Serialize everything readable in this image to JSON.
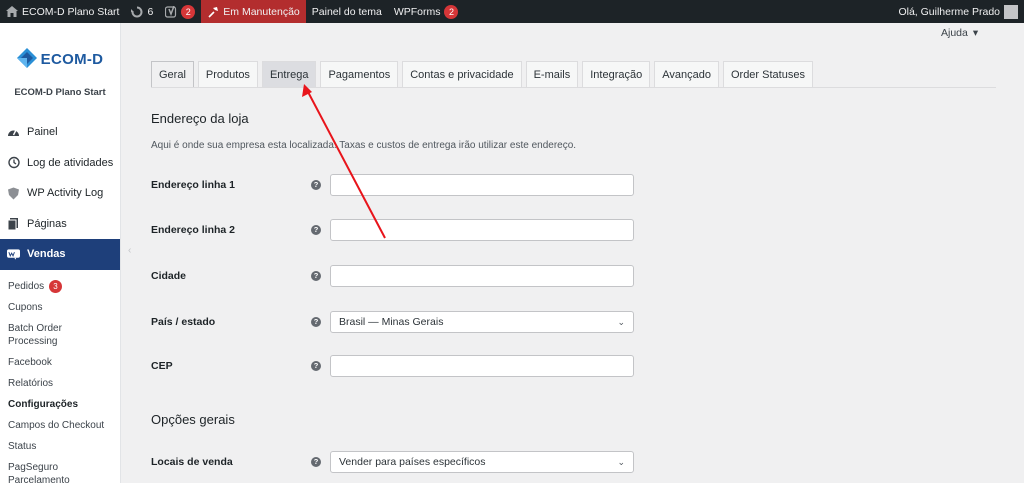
{
  "adminbar": {
    "site_name": "ECOM-D Plano Start",
    "updates_count": "6",
    "yoast_count": "2",
    "maintenance": "Em Manutenção",
    "theme_panel": "Painel do tema",
    "wpforms": "WPForms",
    "wpforms_count": "2",
    "greeting": "Olá, Guilherme Prado"
  },
  "sidebar": {
    "logo_text": "ECOM-D",
    "site_name": "ECOM-D Plano Start",
    "items": [
      {
        "label": "Painel",
        "icon": "dashboard-icon"
      },
      {
        "label": "Log de atividades",
        "icon": "history-icon"
      },
      {
        "label": "WP Activity Log",
        "icon": "shield-icon"
      },
      {
        "label": "Páginas",
        "icon": "pages-icon"
      },
      {
        "label": "Vendas",
        "icon": "woo-icon"
      }
    ],
    "submenu": [
      {
        "label": "Pedidos",
        "badge": "3"
      },
      {
        "label": "Cupons"
      },
      {
        "label": "Batch Order Processing"
      },
      {
        "label": "Facebook"
      },
      {
        "label": "Relatórios"
      },
      {
        "label": "Configurações"
      },
      {
        "label": "Campos do Checkout"
      },
      {
        "label": "Status"
      },
      {
        "label": "PagSeguro Parcelamento"
      }
    ]
  },
  "help": {
    "label": "Ajuda"
  },
  "tabs": [
    "Geral",
    "Produtos",
    "Entrega",
    "Pagamentos",
    "Contas e privacidade",
    "E-mails",
    "Integração",
    "Avançado",
    "Order Statuses"
  ],
  "store_address": {
    "title": "Endereço da loja",
    "description": "Aqui é onde sua empresa esta localizada. Taxas e custos de entrega irão utilizar este endereço.",
    "fields": [
      {
        "label": "Endereço linha 1",
        "value": ""
      },
      {
        "label": "Endereço linha 2",
        "value": ""
      },
      {
        "label": "Cidade",
        "value": ""
      },
      {
        "label": "País / estado",
        "value": "Brasil — Minas Gerais"
      },
      {
        "label": "CEP",
        "value": ""
      }
    ]
  },
  "general_options": {
    "title": "Opções gerais",
    "fields": [
      {
        "label": "Locais de venda",
        "value": "Vender para países específicos"
      }
    ]
  },
  "colors": {
    "adminbar": "#1d2327",
    "maintenance": "#b32d2e",
    "active_menu": "#1e3f7a",
    "arrow": "#e8141b"
  }
}
